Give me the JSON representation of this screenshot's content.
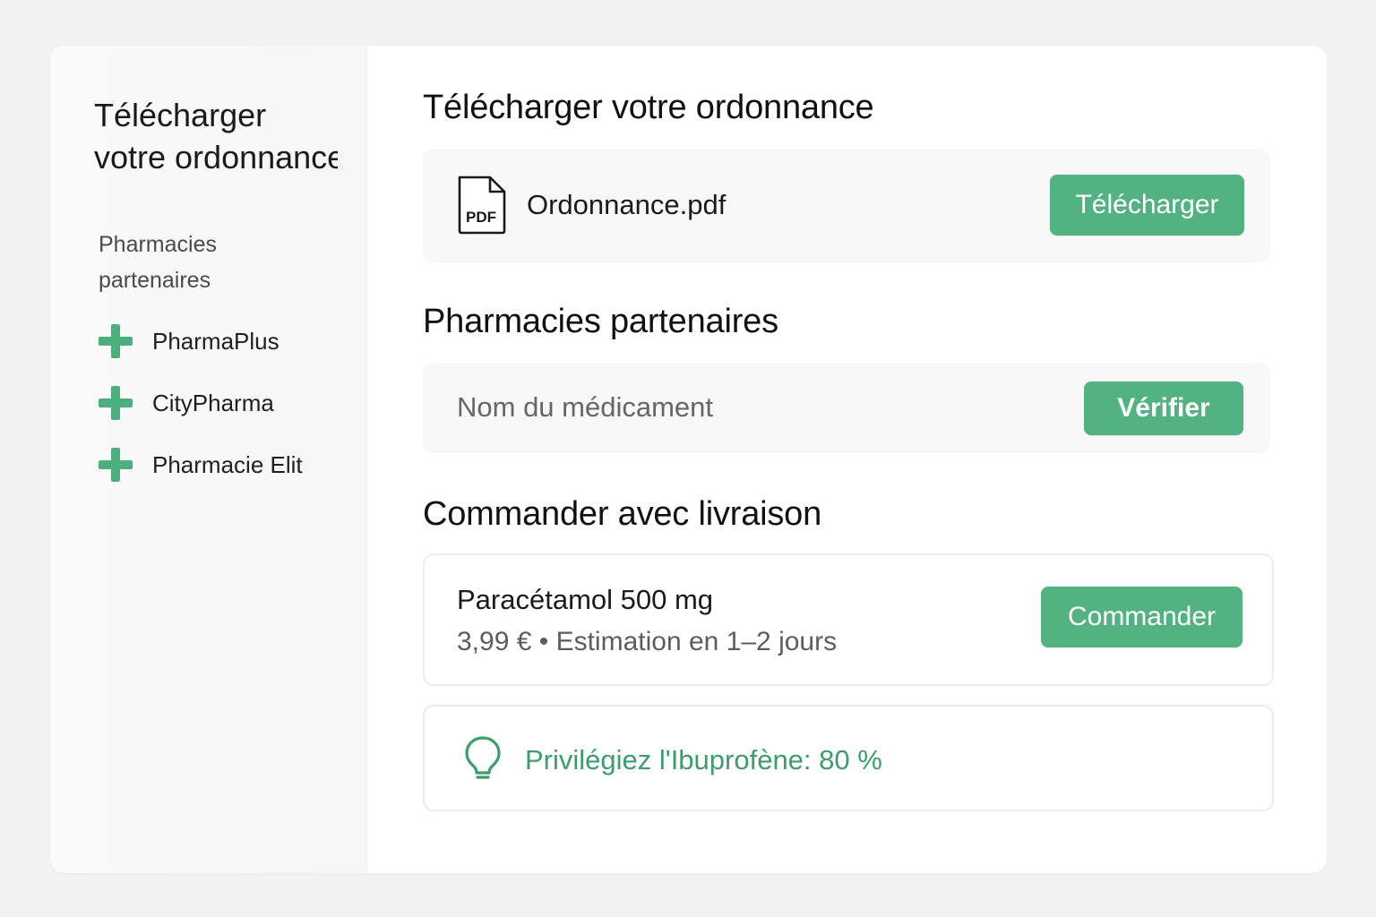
{
  "sidebar": {
    "title_line1": "Télécharger",
    "title_line2": "votre ordonnance",
    "section_label": "Pharmacies partenaires",
    "items": [
      {
        "label": "PharmaPlus",
        "icon": "plus-icon"
      },
      {
        "label": "CityPharma",
        "icon": "plus-icon"
      },
      {
        "label": "Pharmacie Elit",
        "icon": "plus-icon"
      }
    ]
  },
  "upload": {
    "heading": "Télécharger votre ordonnance",
    "file_icon_text": "PDF",
    "file_name": "Ordonnance.pdf",
    "button_label": "Télécharger"
  },
  "partners": {
    "heading": "Pharmacies partenaires",
    "input_placeholder": "Nom du médicament",
    "input_value": "",
    "button_label": "Vérifier"
  },
  "order": {
    "heading": "Commander avec livraison",
    "product_name": "Paracétamol 500 mg",
    "product_meta": "3,99 € • Estimation en 1–2 jours",
    "button_label": "Commander"
  },
  "tip": {
    "icon": "lightbulb-icon",
    "text": "Privilégiez l'Ibuprofène: 80 %"
  },
  "colors": {
    "accent": "#52b282",
    "accent_text": "#3c9e6c",
    "background": "#f2f2f2"
  }
}
